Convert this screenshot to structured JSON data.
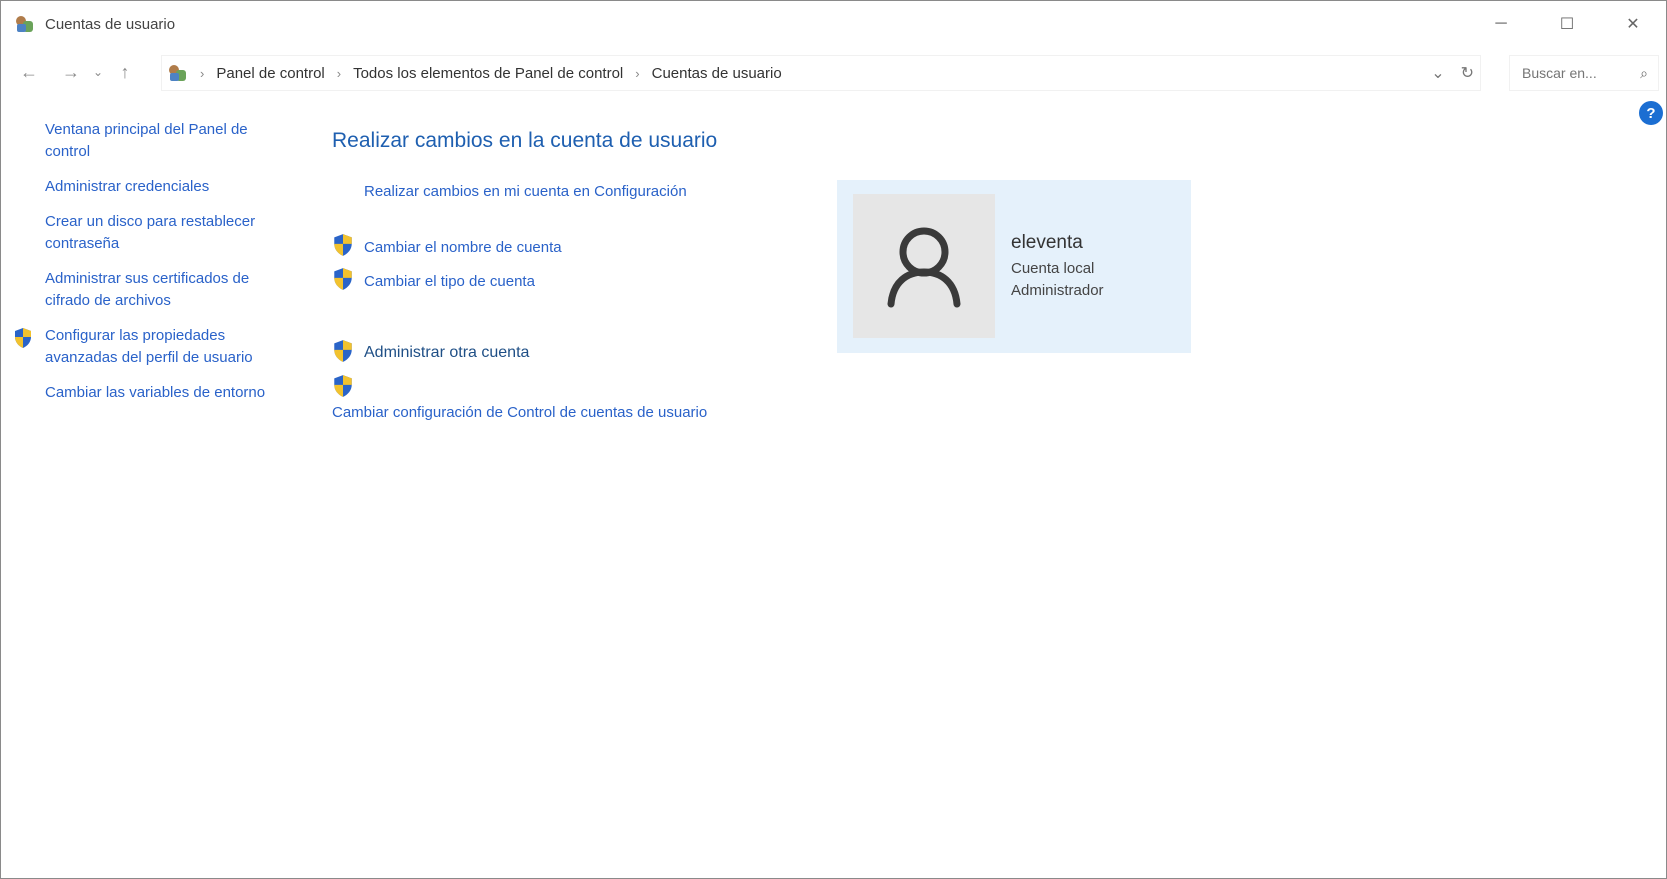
{
  "window": {
    "title": "Cuentas de usuario",
    "controls": {
      "minimize": "─",
      "maximize": "☐",
      "close": "✕"
    }
  },
  "nav": {
    "back_icon": "arrow-left-icon",
    "forward_icon": "arrow-right-icon",
    "up_icon": "arrow-up-icon",
    "breadcrumbs": [
      "Panel de control",
      "Todos los elementos de Panel de control",
      "Cuentas de usuario"
    ],
    "search_placeholder": "Buscar en..."
  },
  "help_label": "?",
  "sidebar": {
    "items": [
      {
        "label": "Ventana principal del Panel de control",
        "shield": false
      },
      {
        "label": "Administrar credenciales",
        "shield": false
      },
      {
        "label": "Crear un disco para restablecer contraseña",
        "shield": false
      },
      {
        "label": "Administrar sus certificados de cifrado de archivos",
        "shield": false
      },
      {
        "label": "Configurar las propiedades avanzadas del perfil de usuario",
        "shield": true
      },
      {
        "label": "Cambiar las variables de entorno",
        "shield": false
      }
    ]
  },
  "main": {
    "title": "Realizar cambios en la cuenta de usuario",
    "settings_link": "Realizar cambios en mi cuenta en Configuración",
    "change_name": "Cambiar el nombre de cuenta",
    "change_type": "Cambiar el tipo de cuenta",
    "manage_other": "Administrar otra cuenta",
    "uac_settings": "Cambiar configuración de Control de cuentas de usuario"
  },
  "user": {
    "name": "eleventa",
    "type": "Cuenta local",
    "role": "Administrador"
  },
  "colors": {
    "link": "#2a62c9",
    "title": "#1e5fb0",
    "card_bg": "#e5f1fb",
    "help": "#1b6ed2"
  }
}
